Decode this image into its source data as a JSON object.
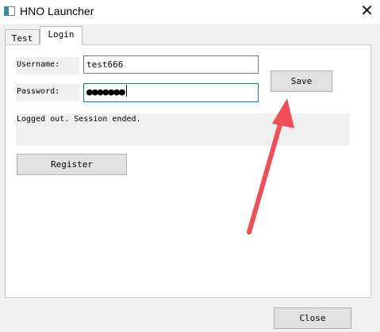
{
  "window": {
    "title": "HNO Launcher",
    "close_glyph": "✕",
    "app_icon": "hno-launcher-icon",
    "accent_color": "#0078d7"
  },
  "tabs": [
    {
      "label": "Test",
      "selected": false
    },
    {
      "label": "Login",
      "selected": true
    }
  ],
  "login": {
    "username_label": "Username:",
    "username_value": "test666",
    "password_label": "Password:",
    "password_mask": "●●●●●●●",
    "save_label": "Save",
    "status_text": "Logged out. Session ended.",
    "register_label": "Register"
  },
  "footer": {
    "close_label": "Close"
  },
  "annotation": {
    "type": "arrow",
    "color": "#ef4f5b",
    "points_to": "save-button"
  }
}
